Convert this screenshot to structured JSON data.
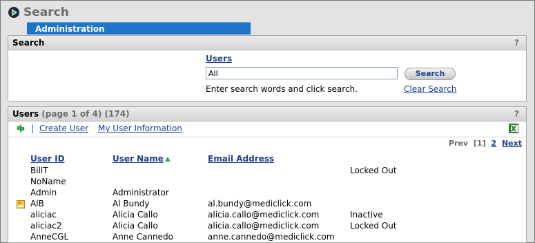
{
  "app": {
    "title": "Search"
  },
  "tab": {
    "label": "Administration"
  },
  "search_panel": {
    "title": "Search",
    "help": "?",
    "field_label": "Users",
    "input_value": "All",
    "search_button": "Search",
    "hint": "Enter search words and click search.",
    "clear_link": "Clear Search"
  },
  "users_panel": {
    "title": "Users",
    "page_info": "(page 1 of 4) (174)",
    "help": "?",
    "toolbar": {
      "separator": "|",
      "create_user": "Create User",
      "my_info": "My User Information"
    },
    "pager": {
      "prev": "Prev",
      "current": "[1]",
      "page2": "2",
      "next": "Next"
    },
    "columns": [
      "User ID",
      "User Name",
      "Email Address"
    ],
    "rows": [
      {
        "id": "BillT",
        "name": "",
        "email": "",
        "status": "Locked Out",
        "icon": ""
      },
      {
        "id": "NoName",
        "name": "",
        "email": "",
        "status": "",
        "icon": ""
      },
      {
        "id": "Admin",
        "name": "Administrator",
        "email": "",
        "status": "",
        "icon": ""
      },
      {
        "id": "AlB",
        "name": "Al Bundy",
        "email": "al.bundy@mediclick.com",
        "status": "",
        "icon": "user-card-icon"
      },
      {
        "id": "aliciac",
        "name": "Alicia Callo",
        "email": "alicia.callo@mediclick.com",
        "status": "Inactive",
        "icon": ""
      },
      {
        "id": "aliciac2",
        "name": "Alicia Callo",
        "email": "alicia.callo@mediclick.com",
        "status": "Locked Out",
        "icon": ""
      },
      {
        "id": "AnneCGL",
        "name": "Anne Cannedo",
        "email": "anne.cannedo@mediclick.com",
        "status": "",
        "icon": ""
      }
    ]
  },
  "colors": {
    "tab_blue": "#1e74c8",
    "link_blue": "#1f3f8f",
    "sort_arrow": "#3aa35a"
  }
}
